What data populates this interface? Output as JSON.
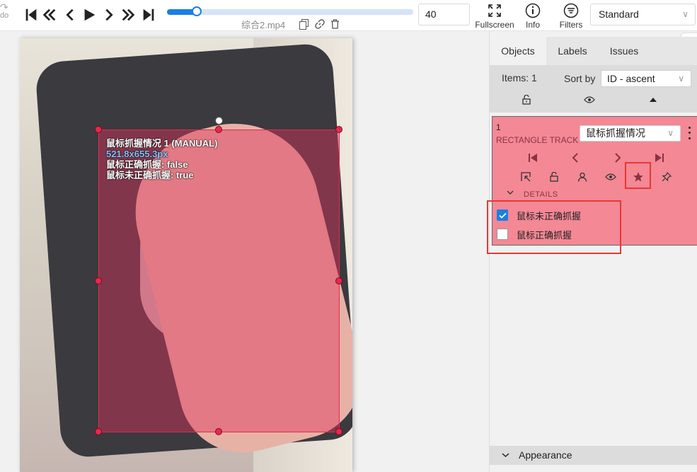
{
  "toolbar": {
    "redo_label": "do",
    "frame_number": "40",
    "filename": "综合2.mp4",
    "fullscreen_label": "Fullscreen",
    "info_label": "Info",
    "filters_label": "Filters",
    "workspace_value": "Standard",
    "progress": 0.12
  },
  "annotation": {
    "title": "鼠标抓握情况 1 (MANUAL)",
    "dimensions": "521.8x655.3px",
    "attr_line_1": "鼠标正确抓握: false",
    "attr_line_2": "鼠标未正确抓握: true",
    "color": "#e8284e"
  },
  "sidebar": {
    "tabs": [
      "Objects",
      "Labels",
      "Issues"
    ],
    "items_count": "Items: 1",
    "sort_label": "Sort by",
    "sort_value": "ID - ascent",
    "object": {
      "id": "1",
      "type": "RECTANGLE TRACK",
      "label": "鼠标抓握情况",
      "details_label": "DETAILS",
      "attributes": [
        {
          "name": "鼠标未正确抓握",
          "checked": true
        },
        {
          "name": "鼠标正确抓握",
          "checked": false
        }
      ]
    },
    "appearance_label": "Appearance"
  },
  "colors": {
    "accent": "#1a7fe6",
    "object_card": "#f48895",
    "highlight": "#e53935"
  }
}
